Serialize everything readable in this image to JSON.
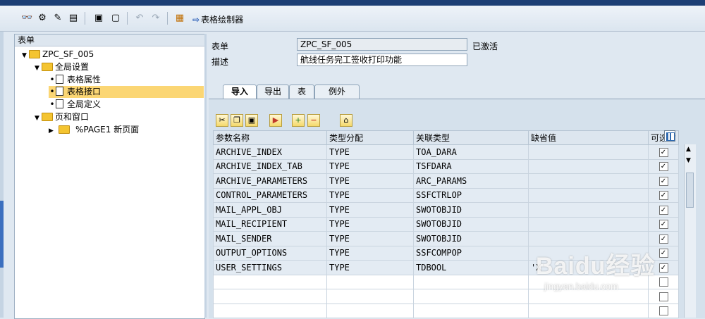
{
  "toolbar": {
    "icons": [
      "glasses-icon",
      "hierarchy-icon",
      "magic-wand-icon",
      "display-icon",
      "frame-icon",
      "frame2-icon",
      "undo-icon",
      "redo-icon",
      "chart-icon"
    ],
    "form_painter_label": "表格绘制器"
  },
  "nav": {
    "header": "表单",
    "root": "ZPC_SF_005",
    "global_settings": "全局设置",
    "form_attributes": "表格属性",
    "form_interface": "表格接口",
    "global_definitions": "全局定义",
    "pages_windows": "页和窗口",
    "page1": "%PAGE1 新页面"
  },
  "header": {
    "form_label": "表单",
    "form_value": "ZPC_SF_005",
    "status": "已激活",
    "desc_label": "描述",
    "desc_value": "航线任务完工签收打印功能"
  },
  "tabs": [
    "导入",
    "导出",
    "表",
    "例外"
  ],
  "table": {
    "columns": [
      "参数名称",
      "类型分配",
      "关联类型",
      "缺省值",
      "可选的"
    ],
    "rows": [
      {
        "name": "ARCHIVE_INDEX",
        "type": "TYPE",
        "ref": "TOA_DARA",
        "default": "",
        "optional": "✓"
      },
      {
        "name": "ARCHIVE_INDEX_TAB",
        "type": "TYPE",
        "ref": "TSFDARA",
        "default": "",
        "optional": "✓"
      },
      {
        "name": "ARCHIVE_PARAMETERS",
        "type": "TYPE",
        "ref": "ARC_PARAMS",
        "default": "",
        "optional": "✓"
      },
      {
        "name": "CONTROL_PARAMETERS",
        "type": "TYPE",
        "ref": "SSFCTRLOP",
        "default": "",
        "optional": "✓"
      },
      {
        "name": "MAIL_APPL_OBJ",
        "type": "TYPE",
        "ref": "SWOTOBJID",
        "default": "",
        "optional": "✓"
      },
      {
        "name": "MAIL_RECIPIENT",
        "type": "TYPE",
        "ref": "SWOTOBJID",
        "default": "",
        "optional": "✓"
      },
      {
        "name": "MAIL_SENDER",
        "type": "TYPE",
        "ref": "SWOTOBJID",
        "default": "",
        "optional": "✓"
      },
      {
        "name": "OUTPUT_OPTIONS",
        "type": "TYPE",
        "ref": "SSFCOMPOP",
        "default": "",
        "optional": "✓"
      },
      {
        "name": "USER_SETTINGS",
        "type": "TYPE",
        "ref": "TDBOOL",
        "default": "'X'",
        "optional": "✓"
      },
      {
        "name": "",
        "type": "",
        "ref": "",
        "default": "",
        "optional": ""
      },
      {
        "name": "",
        "type": "",
        "ref": "",
        "default": "",
        "optional": ""
      },
      {
        "name": "",
        "type": "",
        "ref": "",
        "default": "",
        "optional": ""
      }
    ]
  },
  "watermark": {
    "big": "Baidu经验",
    "small": "jingyan.baidu.com"
  }
}
